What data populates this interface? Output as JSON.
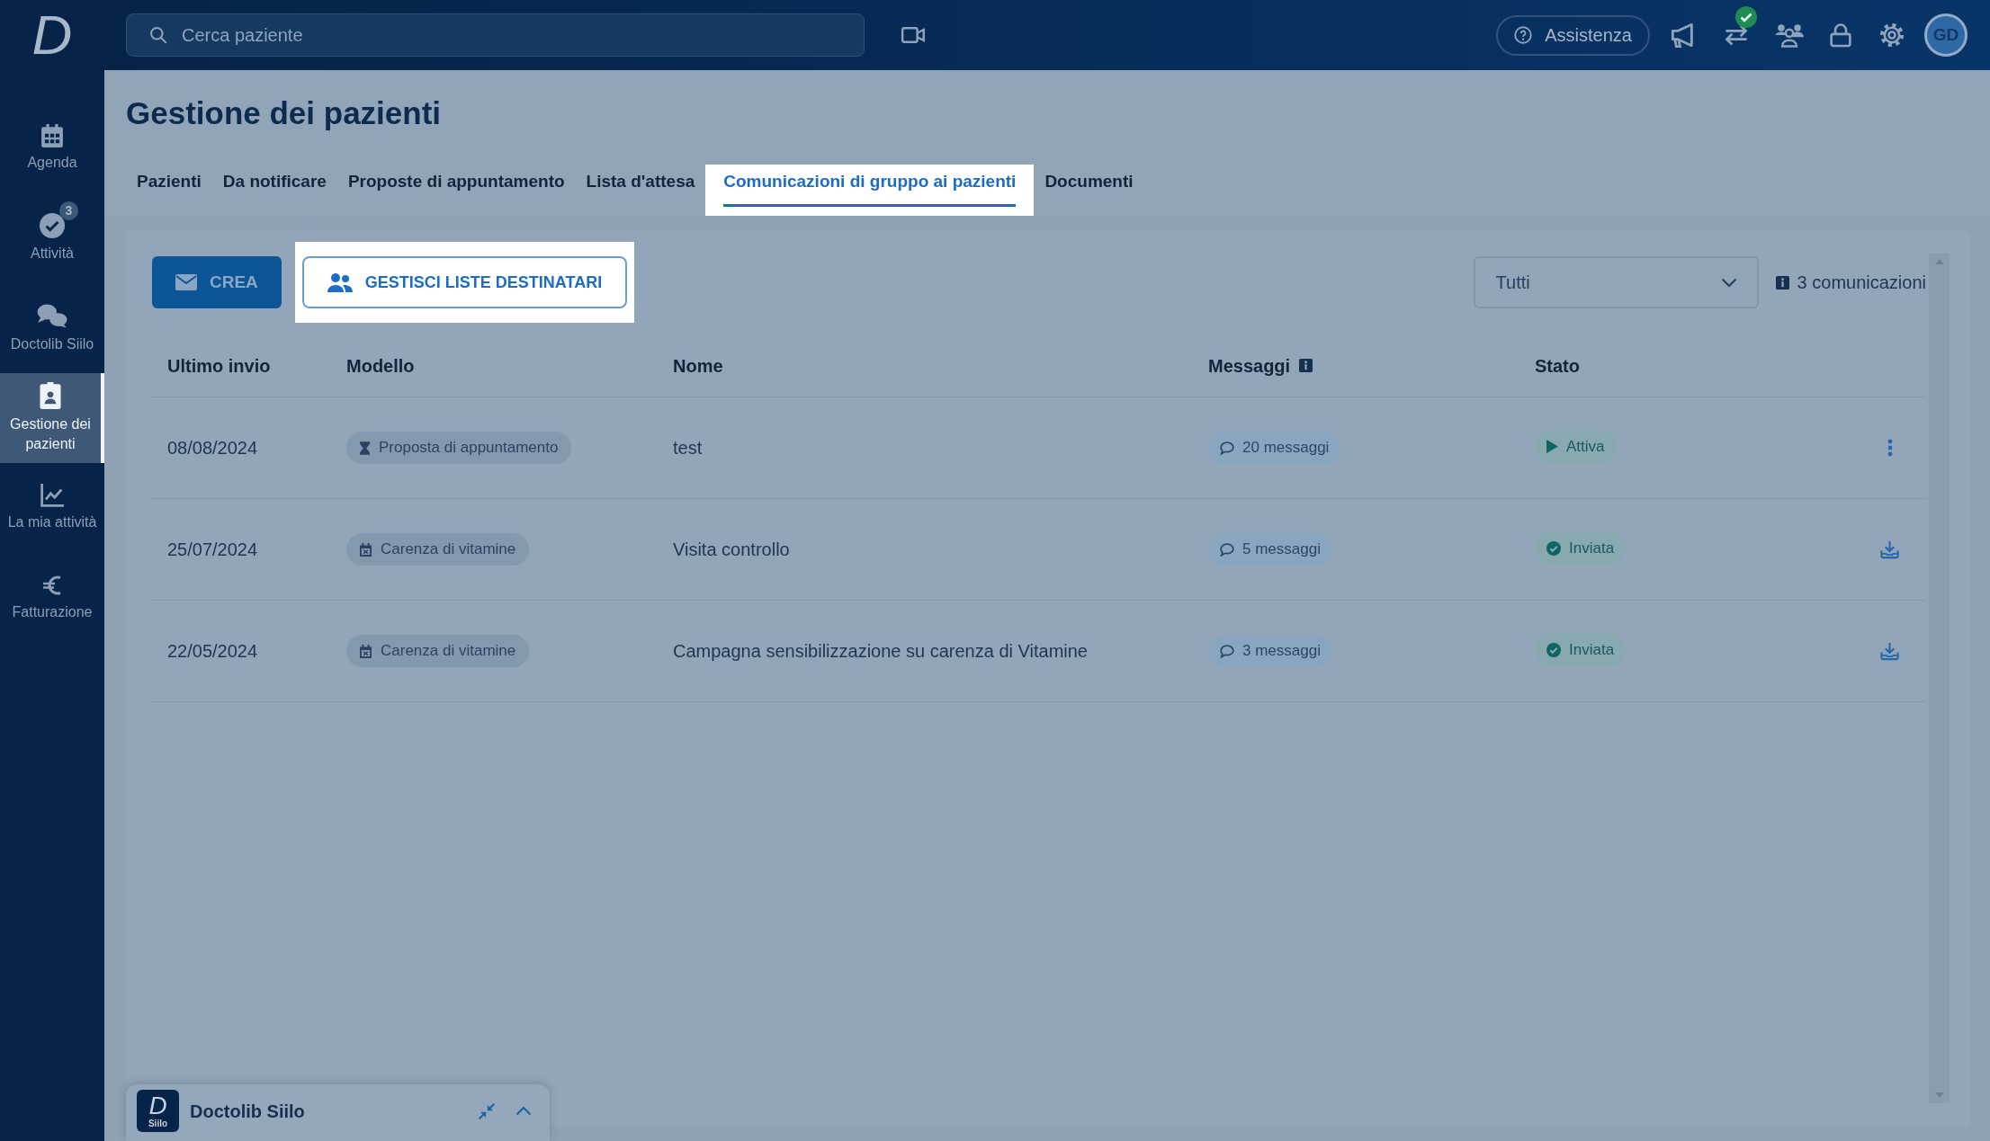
{
  "sidebar": {
    "logo": "D",
    "items": [
      {
        "label": "Agenda",
        "selected": false
      },
      {
        "label": "Attività",
        "selected": false,
        "badge": "3"
      },
      {
        "label": "Doctolib Siilo",
        "selected": false
      },
      {
        "label": "Gestione dei pazienti",
        "selected": true
      },
      {
        "label": "La mia attività",
        "selected": false
      },
      {
        "label": "Fatturazione",
        "selected": false
      }
    ]
  },
  "topbar": {
    "search": {
      "placeholder": "Cerca paziente"
    },
    "help_button": "Assistenza",
    "avatar": "GD"
  },
  "page": {
    "title": "Gestione dei pazienti",
    "tabs": [
      {
        "label": "Pazienti",
        "selected": false,
        "spotlighted": false
      },
      {
        "label": "Da notificare",
        "selected": false,
        "spotlighted": false
      },
      {
        "label": "Proposte di appuntamento",
        "selected": false,
        "spotlighted": false
      },
      {
        "label": "Lista d'attesa",
        "selected": false,
        "spotlighted": false
      },
      {
        "label": "Comunicazioni di gruppo ai pazienti",
        "selected": true,
        "spotlighted": true
      },
      {
        "label": "Documenti",
        "selected": false,
        "spotlighted": false
      }
    ]
  },
  "toolbar": {
    "create_button": {
      "label": "CREA",
      "spotlighted": false
    },
    "manage_button": {
      "label": "GESTISCI LISTE DESTINATARI",
      "spotlighted": true
    },
    "filter": {
      "value": "Tutti"
    },
    "count": "3 comunicazioni"
  },
  "table": {
    "columns": [
      {
        "label": "Ultimo invio",
        "info": false
      },
      {
        "label": "Modello",
        "info": false
      },
      {
        "label": "Nome",
        "info": false
      },
      {
        "label": "Messaggi",
        "info": true
      },
      {
        "label": "Stato",
        "info": false
      }
    ],
    "rows": [
      {
        "last_sent": "08/08/2024",
        "template": {
          "label": "Proposta di appuntamento",
          "kind": "appointment"
        },
        "name": "test",
        "messages": "20 messaggi",
        "status": {
          "label": "Attiva",
          "kind": "active"
        },
        "action": {
          "kind": "menu"
        }
      },
      {
        "last_sent": "25/07/2024",
        "template": {
          "label": "Carenza di vitamine",
          "kind": "campaign"
        },
        "name": "Visita controllo",
        "messages": "5 messaggi",
        "status": {
          "label": "Inviata",
          "kind": "sent"
        },
        "action": {
          "kind": "download"
        }
      },
      {
        "last_sent": "22/05/2024",
        "template": {
          "label": "Carenza di vitamine",
          "kind": "campaign"
        },
        "name": "Campagna sensibilizzazione su carenza di Vitamine",
        "messages": "3 messaggi",
        "status": {
          "label": "Inviata",
          "kind": "sent"
        },
        "action": {
          "kind": "download"
        }
      }
    ]
  },
  "chat_widget": {
    "logo": "D",
    "logo_caption": "Siilo",
    "title": "Doctolib Siilo"
  }
}
